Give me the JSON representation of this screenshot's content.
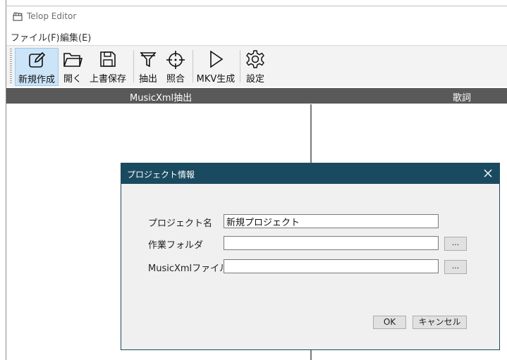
{
  "app": {
    "title": "Telop Editor"
  },
  "menu": {
    "items": [
      {
        "label": "ファイル(F)"
      },
      {
        "label": "編集(E)"
      }
    ]
  },
  "toolbar": {
    "buttons": [
      {
        "label": "新規作成",
        "icon": "new-edit-icon",
        "active": true
      },
      {
        "label": "開く",
        "icon": "folder-open-icon"
      },
      {
        "label": "上書保存",
        "icon": "save-icon"
      },
      {
        "label": "抽出",
        "icon": "filter-icon"
      },
      {
        "label": "照合",
        "icon": "crosshair-icon"
      },
      {
        "label": "MKV生成",
        "icon": "play-icon"
      },
      {
        "label": "設定",
        "icon": "gear-icon"
      }
    ]
  },
  "panels": {
    "left_header": "MusicXml抽出",
    "right_header": "歌詞"
  },
  "dialog": {
    "title": "プロジェクト情報",
    "fields": {
      "project_name": {
        "label": "プロジェクト名",
        "value": "新規プロジェクト"
      },
      "work_folder": {
        "label": "作業フォルダ",
        "value": ""
      },
      "musicxml_file": {
        "label": "MusicXmlファイル",
        "value": ""
      }
    },
    "browse_label": "...",
    "ok_label": "OK",
    "cancel_label": "キャンセル"
  },
  "colors": {
    "dialog_title_bg": "#1a4a60",
    "toolbar_active_bg": "#cce4f7",
    "header_bar_bg": "#595959"
  }
}
